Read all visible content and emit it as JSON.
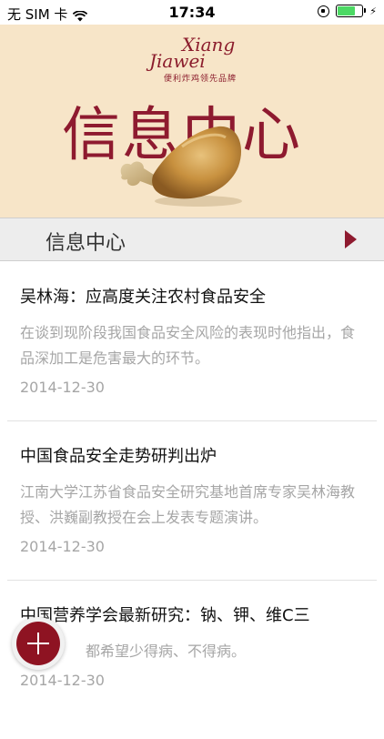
{
  "status_bar": {
    "carrier": "无 SIM 卡",
    "time": "17:34",
    "wifi_icon": "wifi-icon",
    "orientation_lock_icon": "orientation-lock-icon",
    "battery_level": 0.8,
    "charging_icon": "lightning-bolt-icon"
  },
  "banner": {
    "brand_script_line1": "Xiang",
    "brand_script_line2": "Jiawei",
    "brand_tagline": "便利炸鸡领先品牌",
    "title": "信息中心",
    "image": "drumstick-illustration"
  },
  "section": {
    "title": "信息中心",
    "arrow_icon": "triangle-right-icon",
    "accent_color": "#8e1a2f"
  },
  "news": [
    {
      "title": "吴林海：应高度关注农村食品安全",
      "summary": "在谈到现阶段我国食品安全风险的表现时他指出，食品深加工是危害最大的环节。",
      "date": "2014-12-30"
    },
    {
      "title": "中国食品安全走势研判出炉",
      "summary": "江南大学江苏省食品安全研究基地首席专家吴林海教授、洪巍副教授在会上发表专题演讲。",
      "date": "2014-12-30"
    },
    {
      "title": "中国营养学会最新研究：钠、钾、维C三",
      "summary": "都希望少得病、不得病。",
      "date": "2014-12-30"
    }
  ],
  "fab": {
    "icon": "plus-icon",
    "color": "#8e1322"
  }
}
